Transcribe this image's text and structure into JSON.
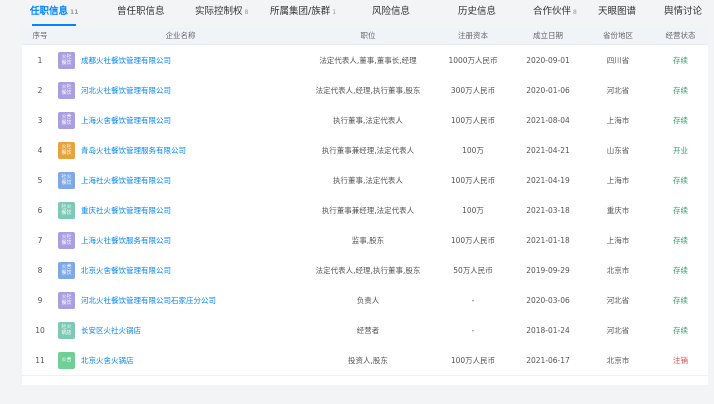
{
  "tabs": [
    {
      "label": "任职信息",
      "count": "11",
      "active": true
    },
    {
      "label": "曾任职信息",
      "count": "",
      "active": false
    },
    {
      "label": "实际控制权",
      "count": "8",
      "active": false
    },
    {
      "label": "所属集团/族群",
      "count": "1",
      "active": false
    },
    {
      "label": "风险信息",
      "count": "",
      "active": false
    },
    {
      "label": "历史信息",
      "count": "",
      "active": false
    },
    {
      "label": "合作伙伴",
      "count": "8",
      "active": false
    },
    {
      "label": "天眼图谱",
      "count": "",
      "active": false
    },
    {
      "label": "舆情讨论",
      "count": "",
      "active": false
    }
  ],
  "headers": {
    "idx": "序号",
    "name": "企业名称",
    "pos": "职位",
    "cap": "注册资本",
    "date": "成立日期",
    "region": "省份地区",
    "status": "经营状态"
  },
  "rows": [
    {
      "idx": "1",
      "logo": "火社\n餐饮",
      "logo_color": "#a89ee0",
      "name": "成都火社餐饮管理有限公司",
      "pos": "法定代表人,董事,董事长,经理",
      "cap": "1000万人民币",
      "date": "2020-09-01",
      "region": "四川省",
      "status": "存续",
      "status_type": "ok"
    },
    {
      "idx": "2",
      "logo": "火社\n餐饮",
      "logo_color": "#a89ee0",
      "name": "河北火社餐饮管理有限公司",
      "pos": "法定代表人,经理,执行董事,股东",
      "cap": "300万人民币",
      "date": "2020-01-06",
      "region": "河北省",
      "status": "存续",
      "status_type": "ok"
    },
    {
      "idx": "3",
      "logo": "火舍\n餐饮",
      "logo_color": "#a89ee0",
      "name": "上海火舍餐饮管理有限公司",
      "pos": "执行董事,法定代表人",
      "cap": "100万人民币",
      "date": "2021-08-04",
      "region": "上海市",
      "status": "存续",
      "status_type": "ok"
    },
    {
      "idx": "4",
      "logo": "火社\n餐饮",
      "logo_color": "#e8a23c",
      "name": "青岛火社餐饮管理服务有限公司",
      "pos": "执行董事兼经理,法定代表人",
      "cap": "100万",
      "date": "2021-04-21",
      "region": "山东省",
      "status": "开业",
      "status_type": "ok"
    },
    {
      "idx": "5",
      "logo": "社火\n餐饮",
      "logo_color": "#7fa8e8",
      "name": "上海社火餐饮管理有限公司",
      "pos": "执行董事,法定代表人",
      "cap": "100万人民币",
      "date": "2021-04-19",
      "region": "上海市",
      "status": "存续",
      "status_type": "ok"
    },
    {
      "idx": "6",
      "logo": "社火\n餐饮",
      "logo_color": "#7cc9b6",
      "name": "重庆社火餐饮管理有限公司",
      "pos": "执行董事兼经理,法定代表人",
      "cap": "100万",
      "date": "2021-03-18",
      "region": "重庆市",
      "status": "存续",
      "status_type": "ok"
    },
    {
      "idx": "7",
      "logo": "火社\n餐饮",
      "logo_color": "#a89ee0",
      "name": "上海火社餐饮服务有限公司",
      "pos": "监事,股东",
      "cap": "100万人民币",
      "date": "2021-01-18",
      "region": "上海市",
      "status": "存续",
      "status_type": "ok"
    },
    {
      "idx": "8",
      "logo": "火舍\n餐饮",
      "logo_color": "#7fa8e8",
      "name": "北京火舍餐饮管理有限公司",
      "pos": "法定代表人,经理,执行董事,股东",
      "cap": "50万人民币",
      "date": "2019-09-29",
      "region": "北京市",
      "status": "存续",
      "status_type": "ok"
    },
    {
      "idx": "9",
      "logo": "火社\n餐饮",
      "logo_color": "#a89ee0",
      "name": "河北火社餐饮管理有限公司石家庄分公司",
      "pos": "负责人",
      "cap": "-",
      "date": "2020-03-06",
      "region": "河北省",
      "status": "存续",
      "status_type": "ok"
    },
    {
      "idx": "10",
      "logo": "社火\n锅店",
      "logo_color": "#7cc9b6",
      "name": "长安区火社火锅店",
      "pos": "经营者",
      "cap": "-",
      "date": "2018-01-24",
      "region": "河北省",
      "status": "存续",
      "status_type": "ok"
    },
    {
      "idx": "11",
      "logo": "火舍",
      "logo_color": "#6fcf97",
      "name": "北京火舍火锅店",
      "pos": "投资人,股东",
      "cap": "100万人民币",
      "date": "2021-06-17",
      "region": "北京市",
      "status": "注销",
      "status_type": "bad"
    }
  ]
}
